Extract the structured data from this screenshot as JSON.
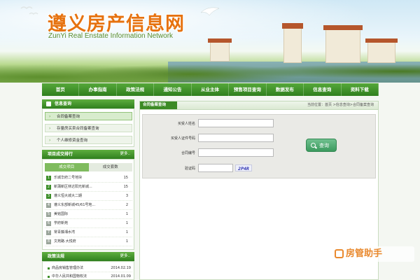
{
  "banner": {
    "title_cn": "遵义房产信息网",
    "title_en": "ZunYi  Real Enstate  Information Network"
  },
  "nav": [
    "首页",
    "办事指南",
    "政策法规",
    "通知公告",
    "从业主体",
    "预售项目查询",
    "数据发布",
    "信息查询",
    "资料下载"
  ],
  "sidebar": {
    "info_query": {
      "title": "信息查询",
      "items": [
        "合同备案查询",
        "存量房买卖合同备案查询",
        "个人维修资金查询"
      ]
    },
    "ranking": {
      "title": "项目成交排行",
      "more": "更多..",
      "tabs": [
        "成交项目",
        "成交套数"
      ],
      "rows": [
        {
          "rank": "1",
          "name": "乐城华府二号地块",
          "count": "15"
        },
        {
          "rank": "2",
          "name": "新蒲新区林达阳光新城...",
          "count": "15"
        },
        {
          "rank": "3",
          "name": "遵义恒大城大二期",
          "count": "3"
        },
        {
          "rank": "4",
          "name": "遵义东部新城45/61号地...",
          "count": "2"
        },
        {
          "rank": "5",
          "name": "美铭国际",
          "count": "1"
        },
        {
          "rank": "6",
          "name": "学府新苑",
          "count": "1"
        },
        {
          "rank": "7",
          "name": "常青藤湘水湾",
          "count": "1"
        },
        {
          "rank": "8",
          "name": "文苑路·大悦府",
          "count": "1"
        }
      ]
    },
    "policy": {
      "title": "政策法规",
      "more": "更多..",
      "rows": [
        {
          "title": "商品房销售管理办法",
          "date": "2014.02.19"
        },
        {
          "title": "中华人民共和国物权法",
          "date": "2014.01.09"
        }
      ]
    }
  },
  "main": {
    "title": "合同备案查询",
    "breadcrumb": "当前位置：首页 >信息查询>合同备案查询",
    "form": {
      "buyer_name": "买受人姓名",
      "buyer_id": "买受人证件号码",
      "contract_no": "合同编号",
      "captcha_label": "验证码",
      "captcha_code": "2P4R",
      "submit": "查询"
    }
  },
  "watermark": "房管助手"
}
